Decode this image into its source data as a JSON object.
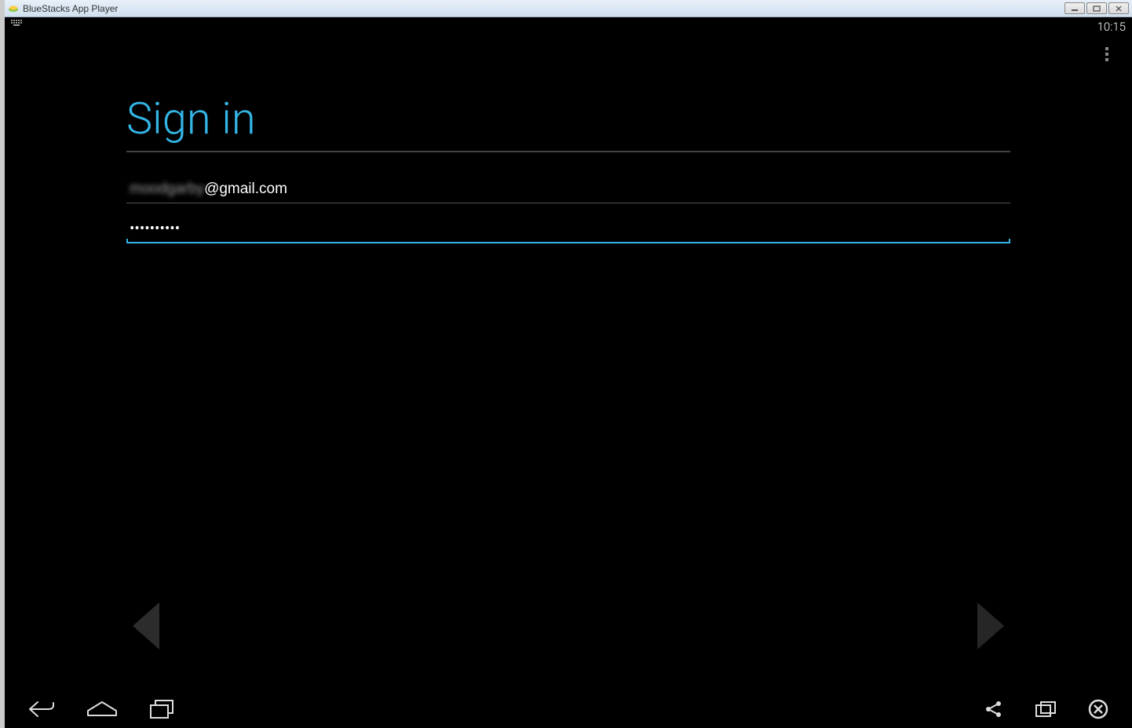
{
  "window": {
    "title": "BlueStacks App Player"
  },
  "statusbar": {
    "time": "10:15"
  },
  "signin": {
    "title": "Sign in",
    "email_prefix_blurred": "moodgarby",
    "email_suffix": "@gmail.com",
    "password_dots": "••••••••••"
  },
  "icons": {
    "keyboard": "keyboard",
    "overflow": "overflow-menu",
    "back_arrow": "back",
    "forward_arrow": "forward",
    "nav_back": "nav-back",
    "nav_home": "nav-home",
    "nav_recent": "nav-recent",
    "nav_share": "nav-share",
    "nav_fullscreen": "nav-fullscreen",
    "nav_close": "nav-close"
  }
}
